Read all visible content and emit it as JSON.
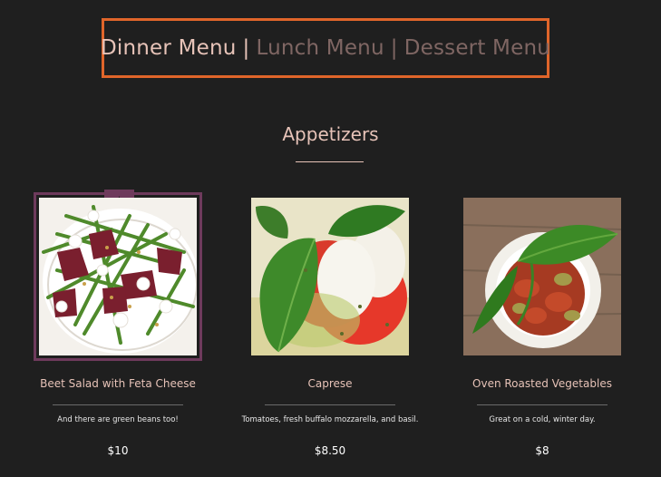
{
  "nav": {
    "tabs": [
      {
        "label": "Dinner Menu",
        "active": true
      },
      {
        "label": "Lunch Menu",
        "active": false
      },
      {
        "label": "Dessert Menu",
        "active": false
      }
    ],
    "separator": "|",
    "accent_border": "#e0652a"
  },
  "section": {
    "title": "Appetizers"
  },
  "items": [
    {
      "name": "Beet Salad with Feta Cheese",
      "description": "And there are green beans too!",
      "price": "$10",
      "featured": true,
      "badge_icon": "★"
    },
    {
      "name": "Caprese",
      "description": "Tomatoes, fresh buffalo mozzarella, and basil.",
      "price": "$8.50",
      "featured": false
    },
    {
      "name": "Oven Roasted Vegetables",
      "description": "Great on a cold, winter day.",
      "price": "$8",
      "featured": false
    }
  ],
  "colors": {
    "background": "#1f1f1f",
    "text_active": "#e7c3b8",
    "text_inactive": "#7f6663",
    "featured_frame": "#6e3a5c"
  }
}
